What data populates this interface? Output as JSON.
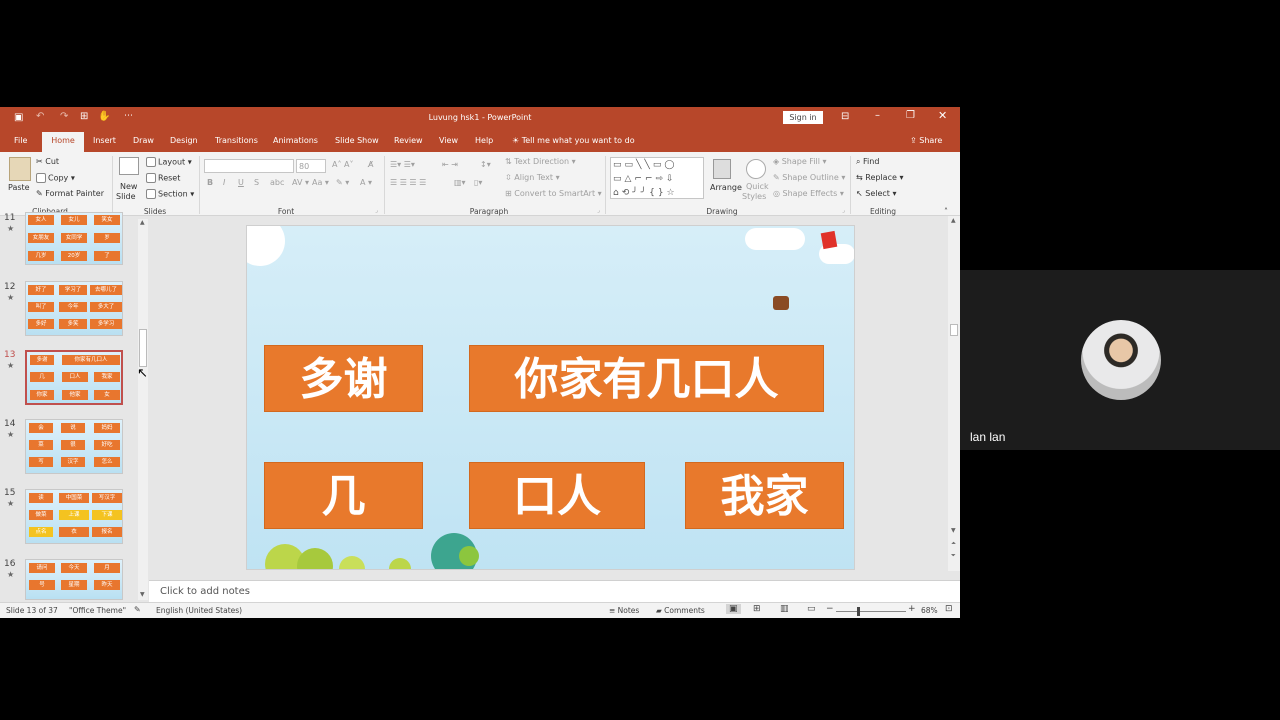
{
  "window": {
    "title": "Luvung hsk1 - PowerPoint",
    "sign_in": "Sign in"
  },
  "quick_access": [
    "save-icon",
    "undo-icon",
    "redo-icon",
    "start-from-beginning-icon",
    "touch-mode-icon",
    "customize-icon"
  ],
  "tabs": [
    "File",
    "Home",
    "Insert",
    "Draw",
    "Design",
    "Transitions",
    "Animations",
    "Slide Show",
    "Review",
    "View",
    "Help"
  ],
  "tell_me": "Tell me what you want to do",
  "share": "Share",
  "ribbon": {
    "clipboard": {
      "paste": "Paste",
      "cut": "Cut",
      "copy": "Copy",
      "format_painter": "Format Painter",
      "label": "Clipboard"
    },
    "slides": {
      "new_slide_1": "New",
      "new_slide_2": "Slide",
      "layout": "Layout",
      "reset": "Reset",
      "section": "Section",
      "label": "Slides"
    },
    "font": {
      "font_size": "80",
      "bold": "B",
      "italic": "I",
      "underline": "U",
      "strike": "S",
      "abc": "abc",
      "label": "Font"
    },
    "paragraph": {
      "text_direction": "Text Direction",
      "align_text": "Align Text",
      "convert": "Convert to SmartArt",
      "label": "Paragraph"
    },
    "drawing": {
      "arrange": "Arrange",
      "quick": "Quick",
      "styles": "Styles",
      "shape_fill": "Shape Fill",
      "shape_outline": "Shape Outline",
      "shape_effects": "Shape Effects",
      "label": "Drawing"
    },
    "editing": {
      "find": "Find",
      "replace": "Replace",
      "select": "Select",
      "label": "Editing"
    }
  },
  "thumbnails": [
    {
      "num": "11",
      "boxes": [
        "女人",
        "女儿",
        "笑女",
        "女朋友",
        "女同学",
        "岁",
        "几岁",
        "20岁",
        "了"
      ]
    },
    {
      "num": "12",
      "boxes": [
        "好了",
        "学习了",
        "去哪儿了",
        "叫了",
        "今年",
        "多大了",
        "多好",
        "多笑",
        "多学习"
      ]
    },
    {
      "num": "13",
      "boxes": [
        "多谢",
        "你家有几口人",
        "几",
        "口人",
        "我家",
        "你家",
        "他家",
        "女"
      ]
    },
    {
      "num": "14",
      "boxes": [
        "会",
        "说",
        "妈妈",
        "菜",
        "很",
        "好吃",
        "写",
        "汉字",
        "怎么"
      ]
    },
    {
      "num": "15",
      "boxes": [
        "读",
        "中国菜",
        "写汉字",
        "做菜",
        "上课",
        "下课",
        "点名",
        "衣",
        "报名"
      ]
    },
    {
      "num": "16",
      "boxes": [
        "请问",
        "今天",
        "月",
        "号",
        "星期",
        "昨天"
      ]
    }
  ],
  "slide": {
    "cards": [
      "多谢",
      "你家有几口人",
      "几",
      "口人",
      "我家",
      "你家",
      "他家",
      "女"
    ]
  },
  "notes_placeholder": "Click to add notes",
  "status": {
    "slide_info": "Slide 13 of 37",
    "theme": "\"Office Theme\"",
    "language": "English (United States)",
    "notes": "Notes",
    "comments": "Comments",
    "zoom": "68%"
  },
  "participant": {
    "name": "lan lan"
  }
}
